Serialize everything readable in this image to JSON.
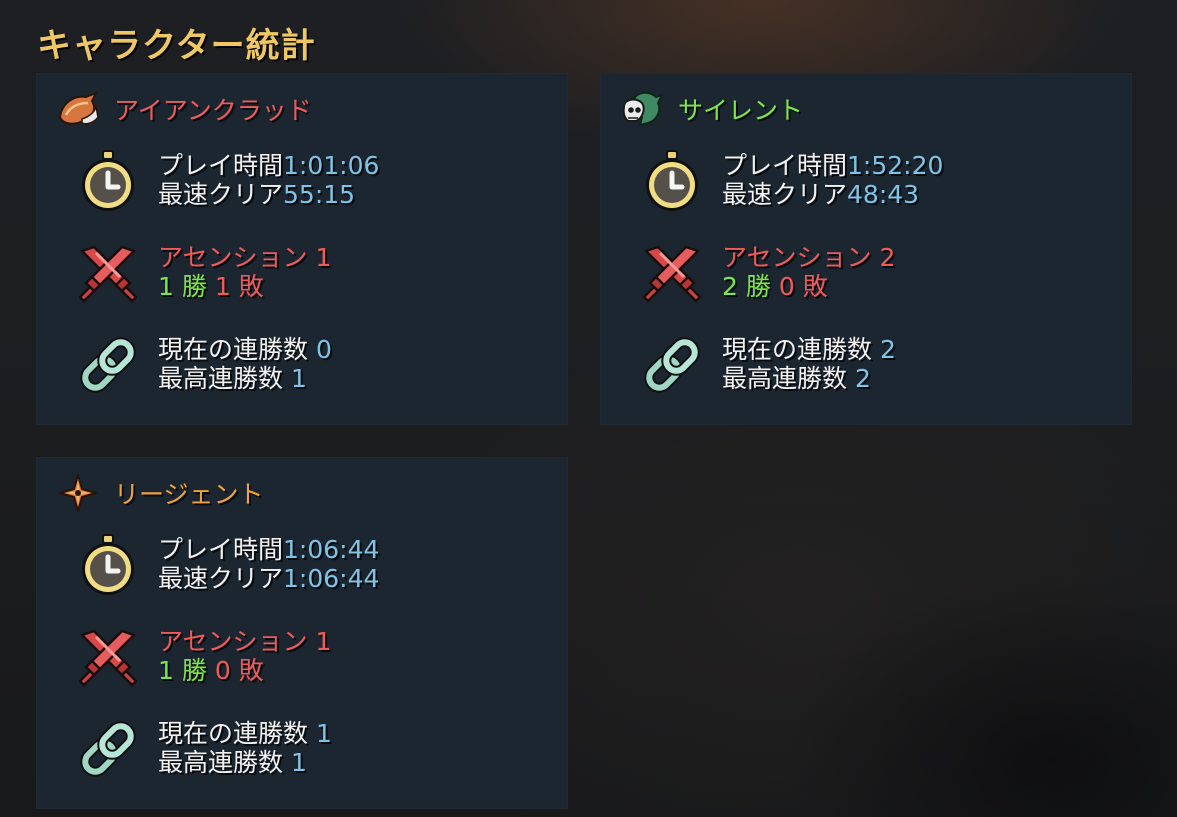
{
  "title": "キャラクター統計",
  "characters": [
    {
      "name": "アイアンクラッド",
      "name_color": "#ee5c5c",
      "icon": "ironclad-helmet-icon",
      "playtime_label": "プレイ時間",
      "playtime": "1:01:06",
      "fastest_label": "最速クリア",
      "fastest": "55:15",
      "ascension_label": "アセンション",
      "ascension": "1",
      "wins": "1",
      "wins_label": "勝",
      "losses": "1",
      "losses_label": "敗",
      "current_streak_label": "現在の連勝数",
      "current_streak": "0",
      "best_streak_label": "最高連勝数",
      "best_streak": "1"
    },
    {
      "name": "サイレント",
      "name_color": "#7ee64a",
      "icon": "silent-skull-icon",
      "playtime_label": "プレイ時間",
      "playtime": "1:52:20",
      "fastest_label": "最速クリア",
      "fastest": "48:43",
      "ascension_label": "アセンション",
      "ascension": "2",
      "wins": "2",
      "wins_label": "勝",
      "losses": "0",
      "losses_label": "敗",
      "current_streak_label": "現在の連勝数",
      "current_streak": "2",
      "best_streak_label": "最高連勝数",
      "best_streak": "2"
    },
    {
      "name": "リージェント",
      "name_color": "#f2a23a",
      "icon": "regent-star-icon",
      "playtime_label": "プレイ時間",
      "playtime": "1:06:44",
      "fastest_label": "最速クリア",
      "fastest": "1:06:44",
      "ascension_label": "アセンション",
      "ascension": "1",
      "wins": "1",
      "wins_label": "勝",
      "losses": "0",
      "losses_label": "敗",
      "current_streak_label": "現在の連勝数",
      "current_streak": "1",
      "best_streak_label": "最高連勝数",
      "best_streak": "1"
    }
  ],
  "icons": {
    "playtime": "stopwatch-icon",
    "ascension": "crossed-swords-icon",
    "streak": "chain-link-icon"
  },
  "colors": {
    "title": "#efc765",
    "label": "#f2f2f2",
    "value": "#7fc4e6",
    "ascension": "#f05a5a",
    "wins": "#7ee64a",
    "losses": "#f05a5a",
    "panel": "#1c2630"
  }
}
